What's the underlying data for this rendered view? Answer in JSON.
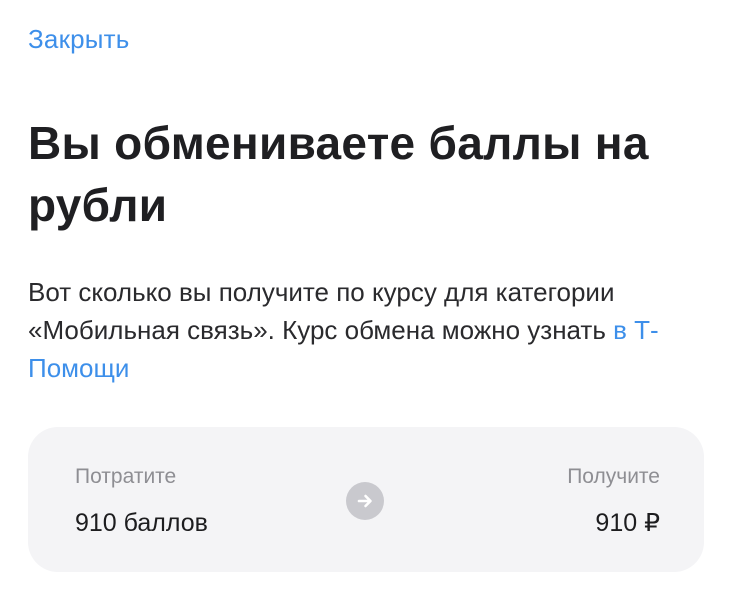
{
  "header": {
    "close_label": "Закрыть"
  },
  "main": {
    "title": "Вы обмениваете баллы на рубли",
    "description_text": "Вот сколько вы получите по курсу для категории «Мобильная связь». Курс обмена можно узнать ",
    "help_link_label": "в Т-Помощи"
  },
  "exchange": {
    "spend_label": "Потратите",
    "spend_value": "910 баллов",
    "receive_label": "Получите",
    "receive_value": "910 ₽",
    "arrow_icon": "arrow-right-icon"
  },
  "colors": {
    "accent": "#3d8fea",
    "card_background": "#f4f4f6",
    "caption_text": "#8e8e93",
    "icon_circle": "#c9c9ce"
  }
}
